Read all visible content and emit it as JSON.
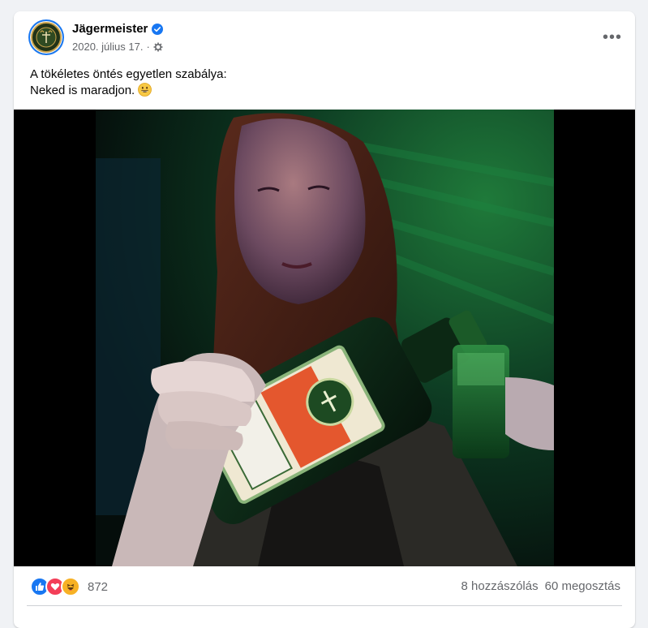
{
  "post": {
    "author": "Jägermeister",
    "date": "2020. július 17.",
    "separator": "·",
    "more_label": "•••",
    "text_line1": "A tökéletes öntés egyetlen szabálya:",
    "text_line2": "Neked is maradjon."
  },
  "reactions": {
    "types": [
      "like-icon",
      "love-icon",
      "haha-icon"
    ],
    "count": "872"
  },
  "stats": {
    "comments": "8 hozzászólás",
    "shares": "60 megosztás"
  },
  "colors": {
    "verified": "#1877f2",
    "like": "#1877f2",
    "love": "#f33e58",
    "haha": "#f7b125",
    "label_orange": "#e4572e",
    "bottle_green": "#0f3d1e"
  }
}
